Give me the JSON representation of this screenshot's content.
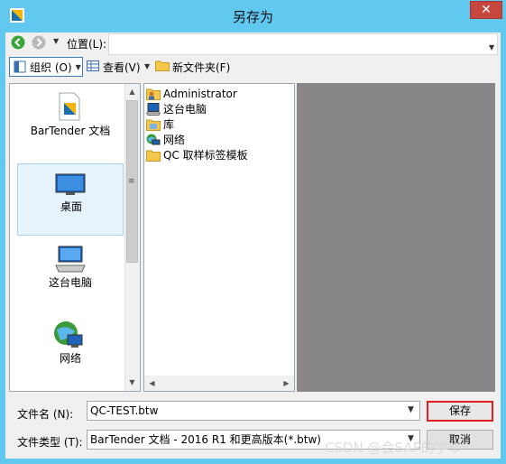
{
  "window": {
    "title": "另存为",
    "close_glyph": "✕"
  },
  "address": {
    "label": "位置(L):",
    "value": ""
  },
  "toolbar": {
    "organize_label": "组织 (O)",
    "view_label": "查看(V)",
    "new_folder_label": "新文件夹(F)"
  },
  "nav": {
    "items": [
      {
        "label": "BarTender 文档",
        "icon": "bartender-docs-icon"
      },
      {
        "label": "桌面",
        "icon": "desktop-icon",
        "selected": true
      },
      {
        "label": "这台电脑",
        "icon": "this-pc-icon"
      },
      {
        "label": "网络",
        "icon": "network-icon"
      }
    ]
  },
  "files": [
    {
      "name": "Administrator",
      "icon": "user-folder-icon"
    },
    {
      "name": "这台电脑",
      "icon": "computer-icon"
    },
    {
      "name": "库",
      "icon": "library-icon"
    },
    {
      "name": "网络",
      "icon": "network-icon"
    },
    {
      "name": "QC 取样标签模板",
      "icon": "folder-icon"
    }
  ],
  "form": {
    "filename_label": "文件名 (N):",
    "filename_value": "QC-TEST.btw",
    "filetype_label": "文件类型 (T):",
    "filetype_value": "BarTender 文档 - 2016 R1 和更高版本(*.btw)",
    "save_label": "保存",
    "cancel_label": "取消"
  },
  "watermark": "CSDN @会SAP的学华",
  "colors": {
    "titlebar": "#61c8ef",
    "close": "#c7463d",
    "preview": "#888689",
    "save_highlight": "#e02020"
  }
}
